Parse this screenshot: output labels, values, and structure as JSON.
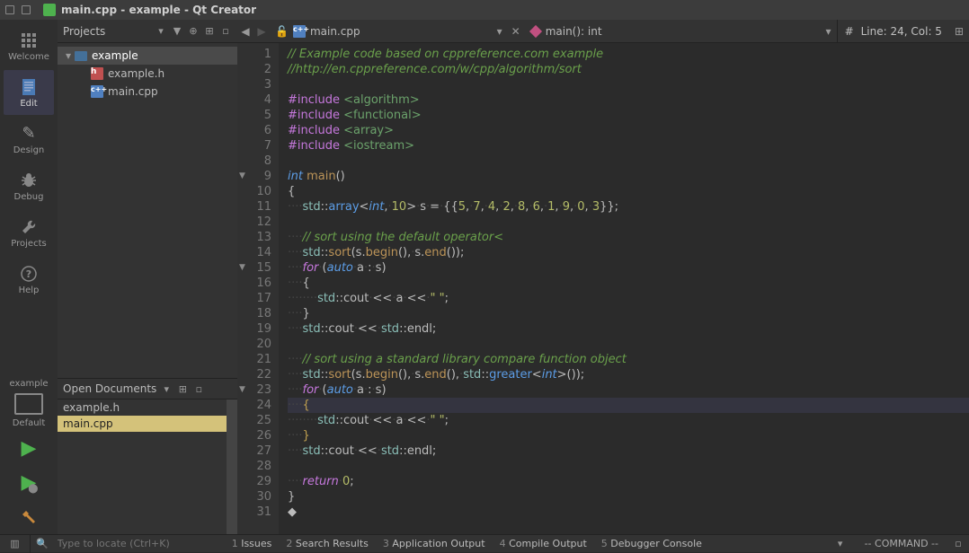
{
  "window": {
    "title": "main.cpp - example - Qt Creator"
  },
  "rail": {
    "welcome": "Welcome",
    "edit": "Edit",
    "design": "Design",
    "debug": "Debug",
    "projects": "Projects",
    "help": "Help",
    "project_name": "example",
    "default": "Default"
  },
  "projects_panel": {
    "header": "Projects",
    "root": "example",
    "files": [
      "example.h",
      "main.cpp"
    ]
  },
  "open_documents": {
    "header": "Open Documents",
    "items": [
      "example.h",
      "main.cpp"
    ],
    "selected": "main.cpp"
  },
  "tabs": {
    "file": "main.cpp",
    "symbol": "main(): int",
    "status": "Line: 24, Col: 5",
    "hash": "#"
  },
  "code": {
    "lines": [
      {
        "n": 1,
        "seg": [
          [
            "com",
            "// Example code based on cppreference.com example"
          ]
        ]
      },
      {
        "n": 2,
        "seg": [
          [
            "com",
            "//http://en.cppreference.com/w/cpp/algorithm/sort"
          ]
        ]
      },
      {
        "n": 3,
        "seg": []
      },
      {
        "n": 4,
        "seg": [
          [
            "pre",
            "#include "
          ],
          [
            "inc",
            "<algorithm>"
          ]
        ]
      },
      {
        "n": 5,
        "seg": [
          [
            "pre",
            "#include "
          ],
          [
            "inc",
            "<functional>"
          ]
        ]
      },
      {
        "n": 6,
        "seg": [
          [
            "pre",
            "#include "
          ],
          [
            "inc",
            "<array>"
          ]
        ]
      },
      {
        "n": 7,
        "seg": [
          [
            "pre",
            "#include "
          ],
          [
            "inc",
            "<iostream>"
          ]
        ]
      },
      {
        "n": 8,
        "seg": []
      },
      {
        "n": 9,
        "fold": true,
        "seg": [
          [
            "kw2",
            "int"
          ],
          [
            "id",
            " "
          ],
          [
            "fn",
            "main"
          ],
          [
            "id",
            "()"
          ]
        ]
      },
      {
        "n": 10,
        "seg": [
          [
            "id",
            "{"
          ]
        ]
      },
      {
        "n": 11,
        "seg": [
          [
            "ws",
            "····"
          ],
          [
            "ns",
            "std"
          ],
          [
            "id",
            "::"
          ],
          [
            "typ",
            "array"
          ],
          [
            "id",
            "<"
          ],
          [
            "kw2",
            "int"
          ],
          [
            "id",
            ","
          ],
          [
            "ws",
            "·"
          ],
          [
            "num",
            "10"
          ],
          [
            "id",
            ">"
          ],
          [
            "ws",
            "·"
          ],
          [
            "id",
            "s"
          ],
          [
            "ws",
            "·"
          ],
          [
            "id",
            "="
          ],
          [
            "ws",
            "·"
          ],
          [
            "id",
            "{{"
          ],
          [
            "num",
            "5"
          ],
          [
            "id",
            ","
          ],
          [
            "ws",
            "·"
          ],
          [
            "num",
            "7"
          ],
          [
            "id",
            ","
          ],
          [
            "ws",
            "·"
          ],
          [
            "num",
            "4"
          ],
          [
            "id",
            ","
          ],
          [
            "ws",
            "·"
          ],
          [
            "num",
            "2"
          ],
          [
            "id",
            ","
          ],
          [
            "ws",
            "·"
          ],
          [
            "num",
            "8"
          ],
          [
            "id",
            ","
          ],
          [
            "ws",
            "·"
          ],
          [
            "num",
            "6"
          ],
          [
            "id",
            ","
          ],
          [
            "ws",
            "·"
          ],
          [
            "num",
            "1"
          ],
          [
            "id",
            ","
          ],
          [
            "ws",
            "·"
          ],
          [
            "num",
            "9"
          ],
          [
            "id",
            ","
          ],
          [
            "ws",
            "·"
          ],
          [
            "num",
            "0"
          ],
          [
            "id",
            ","
          ],
          [
            "ws",
            "·"
          ],
          [
            "num",
            "3"
          ],
          [
            "id",
            "}};"
          ]
        ]
      },
      {
        "n": 12,
        "seg": []
      },
      {
        "n": 13,
        "seg": [
          [
            "ws",
            "····"
          ],
          [
            "com",
            "// sort using the default operator<"
          ]
        ]
      },
      {
        "n": 14,
        "seg": [
          [
            "ws",
            "····"
          ],
          [
            "ns",
            "std"
          ],
          [
            "id",
            "::"
          ],
          [
            "fn",
            "sort"
          ],
          [
            "id",
            "(s."
          ],
          [
            "fn",
            "begin"
          ],
          [
            "id",
            "(),"
          ],
          [
            "ws",
            "·"
          ],
          [
            "id",
            "s."
          ],
          [
            "fn",
            "end"
          ],
          [
            "id",
            "());"
          ]
        ]
      },
      {
        "n": 15,
        "fold": true,
        "seg": [
          [
            "ws",
            "····"
          ],
          [
            "kw",
            "for"
          ],
          [
            "ws",
            "·"
          ],
          [
            "id",
            "("
          ],
          [
            "kw2",
            "auto"
          ],
          [
            "ws",
            "·"
          ],
          [
            "id",
            "a"
          ],
          [
            "ws",
            "·"
          ],
          [
            "id",
            ":"
          ],
          [
            "ws",
            "·"
          ],
          [
            "id",
            "s)"
          ]
        ]
      },
      {
        "n": 16,
        "seg": [
          [
            "ws",
            "····"
          ],
          [
            "id",
            "{"
          ]
        ]
      },
      {
        "n": 17,
        "seg": [
          [
            "ws",
            "········"
          ],
          [
            "ns",
            "std"
          ],
          [
            "id",
            "::cout"
          ],
          [
            "ws",
            "·"
          ],
          [
            "id",
            "<<"
          ],
          [
            "ws",
            "·"
          ],
          [
            "id",
            "a"
          ],
          [
            "ws",
            "·"
          ],
          [
            "id",
            "<<"
          ],
          [
            "ws",
            "·"
          ],
          [
            "str",
            "\" \""
          ],
          [
            "id",
            ";"
          ]
        ]
      },
      {
        "n": 18,
        "seg": [
          [
            "ws",
            "····"
          ],
          [
            "id",
            "}"
          ]
        ]
      },
      {
        "n": 19,
        "seg": [
          [
            "ws",
            "····"
          ],
          [
            "ns",
            "std"
          ],
          [
            "id",
            "::cout"
          ],
          [
            "ws",
            "·"
          ],
          [
            "id",
            "<<"
          ],
          [
            "ws",
            "·"
          ],
          [
            "ns",
            "std"
          ],
          [
            "id",
            "::endl;"
          ]
        ]
      },
      {
        "n": 20,
        "seg": []
      },
      {
        "n": 21,
        "seg": [
          [
            "ws",
            "····"
          ],
          [
            "com",
            "// sort using a standard library compare function object"
          ]
        ]
      },
      {
        "n": 22,
        "seg": [
          [
            "ws",
            "····"
          ],
          [
            "ns",
            "std"
          ],
          [
            "id",
            "::"
          ],
          [
            "fn",
            "sort"
          ],
          [
            "id",
            "(s."
          ],
          [
            "fn",
            "begin"
          ],
          [
            "id",
            "(),"
          ],
          [
            "ws",
            "·"
          ],
          [
            "id",
            "s."
          ],
          [
            "fn",
            "end"
          ],
          [
            "id",
            "(),"
          ],
          [
            "ws",
            "·"
          ],
          [
            "ns",
            "std"
          ],
          [
            "id",
            "::"
          ],
          [
            "typ",
            "greater"
          ],
          [
            "id",
            "<"
          ],
          [
            "kw2",
            "int"
          ],
          [
            "id",
            ">());"
          ]
        ]
      },
      {
        "n": 23,
        "fold": true,
        "seg": [
          [
            "ws",
            "····"
          ],
          [
            "kw",
            "for"
          ],
          [
            "ws",
            "·"
          ],
          [
            "id",
            "("
          ],
          [
            "kw2",
            "auto"
          ],
          [
            "ws",
            "·"
          ],
          [
            "id",
            "a"
          ],
          [
            "ws",
            "·"
          ],
          [
            "id",
            ":"
          ],
          [
            "ws",
            "·"
          ],
          [
            "id",
            "s)"
          ]
        ]
      },
      {
        "n": 24,
        "cursor": true,
        "seg": [
          [
            "ws",
            "····"
          ],
          [
            "cur",
            "{"
          ]
        ]
      },
      {
        "n": 25,
        "seg": [
          [
            "ws",
            "········"
          ],
          [
            "ns",
            "std"
          ],
          [
            "id",
            "::cout"
          ],
          [
            "ws",
            "·"
          ],
          [
            "id",
            "<<"
          ],
          [
            "ws",
            "·"
          ],
          [
            "id",
            "a"
          ],
          [
            "ws",
            "·"
          ],
          [
            "id",
            "<<"
          ],
          [
            "ws",
            "·"
          ],
          [
            "str",
            "\" \""
          ],
          [
            "id",
            ";"
          ]
        ]
      },
      {
        "n": 26,
        "seg": [
          [
            "ws",
            "····"
          ],
          [
            "cur",
            "}"
          ]
        ]
      },
      {
        "n": 27,
        "seg": [
          [
            "ws",
            "····"
          ],
          [
            "ns",
            "std"
          ],
          [
            "id",
            "::cout"
          ],
          [
            "ws",
            "·"
          ],
          [
            "id",
            "<<"
          ],
          [
            "ws",
            "·"
          ],
          [
            "ns",
            "std"
          ],
          [
            "id",
            "::endl;"
          ]
        ]
      },
      {
        "n": 28,
        "seg": []
      },
      {
        "n": 29,
        "seg": [
          [
            "ws",
            "····"
          ],
          [
            "kw",
            "return"
          ],
          [
            "ws",
            "·"
          ],
          [
            "num",
            "0"
          ],
          [
            "id",
            ";"
          ]
        ]
      },
      {
        "n": 30,
        "seg": [
          [
            "id",
            "}"
          ]
        ]
      },
      {
        "n": 31,
        "seg": [
          [
            "id",
            "◆"
          ]
        ]
      }
    ]
  },
  "bottom": {
    "locate_placeholder": "Type to locate (Ctrl+K)",
    "tabs": [
      {
        "n": "1",
        "label": "Issues"
      },
      {
        "n": "2",
        "label": "Search Results"
      },
      {
        "n": "3",
        "label": "Application Output"
      },
      {
        "n": "4",
        "label": "Compile Output"
      },
      {
        "n": "5",
        "label": "Debugger Console"
      }
    ],
    "mode": "-- COMMAND --"
  }
}
